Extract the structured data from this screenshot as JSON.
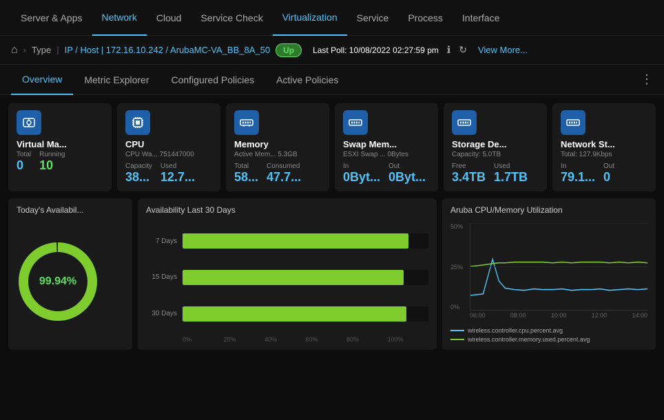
{
  "nav": {
    "items": [
      {
        "label": "Server & Apps",
        "active": false
      },
      {
        "label": "Network",
        "active": false
      },
      {
        "label": "Cloud",
        "active": false
      },
      {
        "label": "Service Check",
        "active": false
      },
      {
        "label": "Virtualization",
        "active": true
      },
      {
        "label": "Service",
        "active": false
      },
      {
        "label": "Process",
        "active": false
      },
      {
        "label": "Interface",
        "active": false
      }
    ]
  },
  "breadcrumb": {
    "home": "⌂",
    "sep": ">",
    "type": "Type",
    "path": "IP / Host | 172.16.10.242 / ArubaMC-VA_BB_8A_50",
    "status": "Up",
    "poll_label": "Last Poll:",
    "poll_time": "10/08/2022 02:27:59 pm",
    "view_more": "View More..."
  },
  "sub_nav": {
    "items": [
      {
        "label": "Overview",
        "active": true
      },
      {
        "label": "Metric Explorer",
        "active": false
      },
      {
        "label": "Configured Policies",
        "active": false
      },
      {
        "label": "Active Policies",
        "active": false
      }
    ]
  },
  "cards": [
    {
      "id": "virtual-machine",
      "icon": "⬡",
      "title": "Virtual Ma...",
      "subtitle": "",
      "values": [
        {
          "label": "Total",
          "value": "0",
          "color": "blue"
        },
        {
          "label": "Running",
          "value": "10",
          "color": "blue"
        }
      ]
    },
    {
      "id": "cpu",
      "icon": "▦",
      "title": "CPU",
      "subtitle": "CPU Wa...  751447000",
      "values": [
        {
          "label": "Capacity",
          "value": "38...",
          "color": "blue"
        },
        {
          "label": "Used",
          "value": "12.7...",
          "color": "blue"
        }
      ]
    },
    {
      "id": "memory",
      "icon": "▬▬",
      "title": "Memory",
      "subtitle": "Active Mem...  5.3GB",
      "values": [
        {
          "label": "Total",
          "value": "58...",
          "color": "blue"
        },
        {
          "label": "Consumed",
          "value": "47.7...",
          "color": "blue"
        }
      ]
    },
    {
      "id": "swap-memory",
      "icon": "▬▬",
      "title": "Swap Mem...",
      "subtitle": "ESXI Swap ...  0Bytes",
      "values": [
        {
          "label": "In",
          "value": "0Byt...",
          "color": "blue"
        },
        {
          "label": "Out",
          "value": "0Byt...",
          "color": "blue"
        }
      ]
    },
    {
      "id": "storage",
      "icon": "▬▬",
      "title": "Storage De...",
      "subtitle": "Capacity: 5.0TB",
      "values": [
        {
          "label": "Free",
          "value": "3.4TB",
          "color": "blue"
        },
        {
          "label": "Used",
          "value": "1.7TB",
          "color": "blue"
        }
      ]
    },
    {
      "id": "network-storage",
      "icon": "▬▬",
      "title": "Network St...",
      "subtitle": "Total: 127.9Kbps",
      "values": [
        {
          "label": "In",
          "value": "79.1...",
          "color": "blue"
        },
        {
          "label": "Out",
          "value": "0",
          "color": "blue"
        }
      ]
    }
  ],
  "availability_today": {
    "title": "Today's Availabil...",
    "percent": "99.94%",
    "ring_value": 99.94
  },
  "availability_30": {
    "title": "Availability Last 30 Days",
    "bars": [
      {
        "label": "7 Days",
        "pct": 92
      },
      {
        "label": "15 Days",
        "pct": 90
      },
      {
        "label": "30 Days",
        "pct": 91
      }
    ],
    "axis_labels": [
      "0%",
      "20%",
      "40%",
      "60%",
      "80%",
      "100%"
    ]
  },
  "cpu_memory": {
    "title": "Aruba CPU/Memory Utilization",
    "y_labels": [
      "50%",
      "25%",
      "0%"
    ],
    "x_labels": [
      "06:00",
      "08:00",
      "10:00",
      "12:00",
      "14:00"
    ],
    "legend": [
      {
        "label": "wireless.controller.cpu.percent.avg",
        "color": "blue"
      },
      {
        "label": "wireless.controller.memory.used.percent.avg",
        "color": "green"
      }
    ]
  }
}
